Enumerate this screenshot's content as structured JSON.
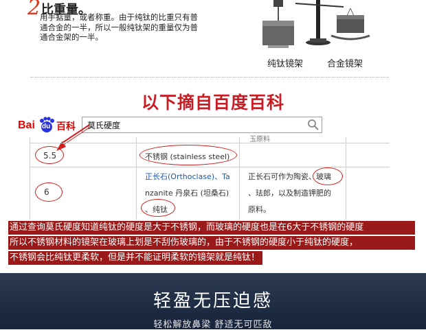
{
  "section": {
    "number": "2",
    "title": "比重量。",
    "body": "用手掂量，或者称重。由于纯钛的比重只有普通合金的一半，所以一般纯钛架的重量仅为普通合金架的一半。",
    "label_titanium": "纯钛镜架",
    "label_alloy": "合金镜架"
  },
  "heading": "以下摘自百度百科",
  "baidu": {
    "logo_bai": "Bai",
    "logo_du": "du",
    "logo_baike": "百科",
    "search_value": "莫氏硬度"
  },
  "table": {
    "partial_top": "玉原料",
    "row1": {
      "hardness": "5.5",
      "material": "不锈钢 (stainless steel)"
    },
    "row2": {
      "hardness": "6",
      "material_line1": "正长石(Orthoclase)、Ta",
      "material_line2": "nzanite 丹泉石 (坦桑石)",
      "material_line3": "、纯钛",
      "note_line1": "正长石可作为陶瓷、玻璃",
      "note_line2": "、珐郎，以及制造钾肥的",
      "note_line3": "原料。"
    }
  },
  "annotation": [
    "通过查询莫氏硬度知道纯钛的硬度是大于不锈钢，而玻璃的硬度也是在6大于不锈钢的硬度",
    "所以不锈钢材料的镜架在玻璃上划是不刮伤玻璃的，由于不锈钢的硬度小于纯钛的硬度，",
    "不锈钢会比纯钛更柔软，但是并不能证明柔软的镜架就是纯钛！"
  ],
  "footer": {
    "title": "轻盈无压迫感",
    "subtitle": "轻松解放鼻梁 舒适无可匹敌"
  },
  "colors": {
    "accent_red": "#c81d25",
    "annotation_bg": "#9a1a1a",
    "baidu_blue": "#2932e1",
    "baidu_red": "#e10602",
    "footer_bg": "#1f2d45"
  }
}
